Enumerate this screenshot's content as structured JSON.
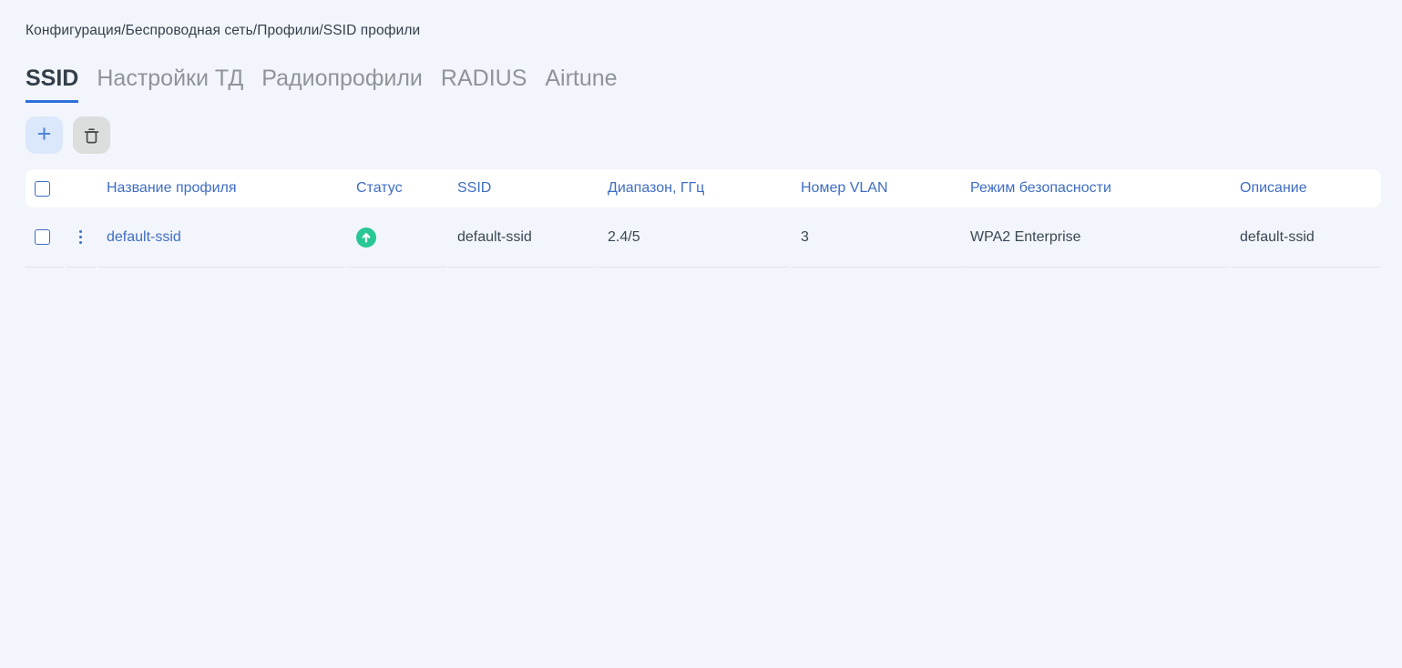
{
  "breadcrumb": {
    "path": "Конфигурация/Беспроводная сеть/Профили/SSID профили"
  },
  "tabs": [
    {
      "label": "SSID",
      "active": true
    },
    {
      "label": "Настройки ТД",
      "active": false
    },
    {
      "label": "Радиопрофили",
      "active": false
    },
    {
      "label": "RADIUS",
      "active": false
    },
    {
      "label": "Airtune",
      "active": false
    }
  ],
  "toolbar": {
    "add_button": {
      "icon": "plus-icon",
      "glyph": "+"
    },
    "delete_button": {
      "icon": "trash-icon"
    }
  },
  "table": {
    "headers": {
      "name": "Название профиля",
      "status": "Статус",
      "ssid": "SSID",
      "band": "Диапазон, ГГц",
      "vlan": "Номер VLAN",
      "security": "Режим безопасности",
      "description": "Описание"
    },
    "rows": [
      {
        "name": "default-ssid",
        "status": "up",
        "ssid": "default-ssid",
        "band": "2.4/5",
        "vlan": "3",
        "security": "WPA2 Enterprise",
        "description": "default-ssid"
      }
    ]
  },
  "colors": {
    "page_background": "#f2f5fb",
    "accent_blue": "#3f6dc3",
    "tab_underline": "#2c6fdd",
    "status_up_green": "#29c795",
    "add_button_bg": "#dbe7fb",
    "delete_button_bg": "#dcdddd"
  }
}
